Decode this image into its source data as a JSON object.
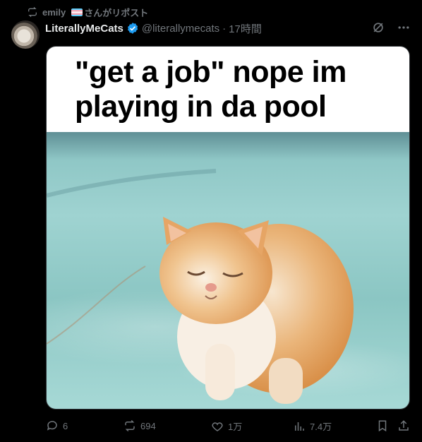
{
  "repost": {
    "user": "emily",
    "suffix": "さんがリポスト"
  },
  "author": {
    "display_name": "LiterallyMeCats",
    "handle": "@literallymecats",
    "separator": "·",
    "time": "17時間"
  },
  "media": {
    "caption": "\"get a job\" nope im playing in da pool"
  },
  "actions": {
    "replies": "6",
    "reposts": "694",
    "likes": "1万",
    "views": "7.4万"
  },
  "colors": {
    "background": "#000000",
    "text": "#e7e9ea",
    "muted": "#71767b",
    "verified": "#1d9bf0"
  }
}
